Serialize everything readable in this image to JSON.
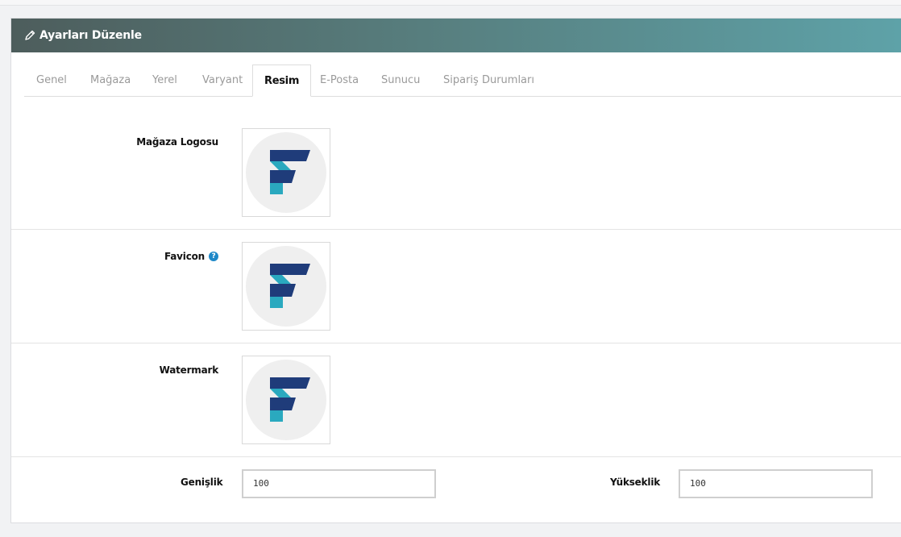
{
  "panel": {
    "title": "Ayarları Düzenle"
  },
  "tabs": [
    {
      "label": "Genel"
    },
    {
      "label": "Mağaza"
    },
    {
      "label": "Yerel"
    },
    {
      "label": "Varyant"
    },
    {
      "label": "Resim",
      "active": true
    },
    {
      "label": "E-Posta"
    },
    {
      "label": "Sunucu"
    },
    {
      "label": "Sipariş Durumları"
    }
  ],
  "images": {
    "logo_label": "Mağaza Logosu",
    "favicon_label": "Favicon",
    "watermark_label": "Watermark"
  },
  "dimensions": {
    "width_label": "Genişlik",
    "width_value": "100",
    "height_label": "Yükseklik",
    "height_value": "100"
  },
  "colors": {
    "logo_dark": "#1f3c7a",
    "logo_teal": "#2aa9bf",
    "logo_bg": "#efefef",
    "help_blue": "#1e88c8"
  }
}
